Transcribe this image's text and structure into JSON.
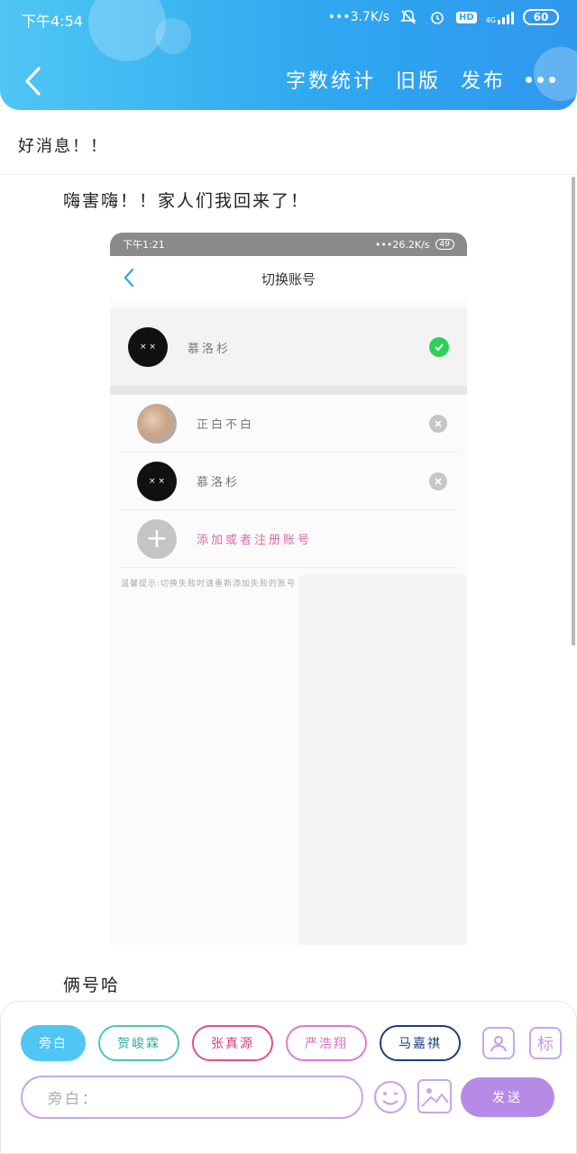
{
  "status_bar": {
    "time": "下午4:54",
    "net_speed": "3.7K/s",
    "hd": "HD",
    "signal": "4G",
    "battery": "60"
  },
  "header": {
    "actions": [
      "字数统计",
      "旧版",
      "发布"
    ],
    "colors": {
      "gradient_start": "#4fc6f3",
      "gradient_end": "#2f98ee"
    }
  },
  "chapter": {
    "title": "好消息！！"
  },
  "content": {
    "line1": "嗨害嗨！！家人们我回来了！",
    "line2": "俩号哈"
  },
  "screenshot": {
    "status_time": "下午1:21",
    "status_speed": "26.2K/s",
    "battery": "49",
    "nav_title": "切换账号",
    "current_account": {
      "name": "慕洛杉",
      "avatar_text": "× ×"
    },
    "accounts": [
      {
        "name": "正白不白"
      },
      {
        "name": "慕洛杉",
        "avatar_text": "× ×"
      }
    ],
    "add_account": "添加或者注册账号",
    "tip": "温馨提示:切换失败时请重新添加失败的账号"
  },
  "editor": {
    "chips": [
      "旁白",
      "贺峻霖",
      "张真源",
      "严浩翔",
      "马嘉祺"
    ],
    "tool_label_person": "person-icon",
    "tool_label_tag": "标",
    "input_placeholder": "旁白：",
    "send_label": "发送",
    "accent": "#b58be6"
  }
}
